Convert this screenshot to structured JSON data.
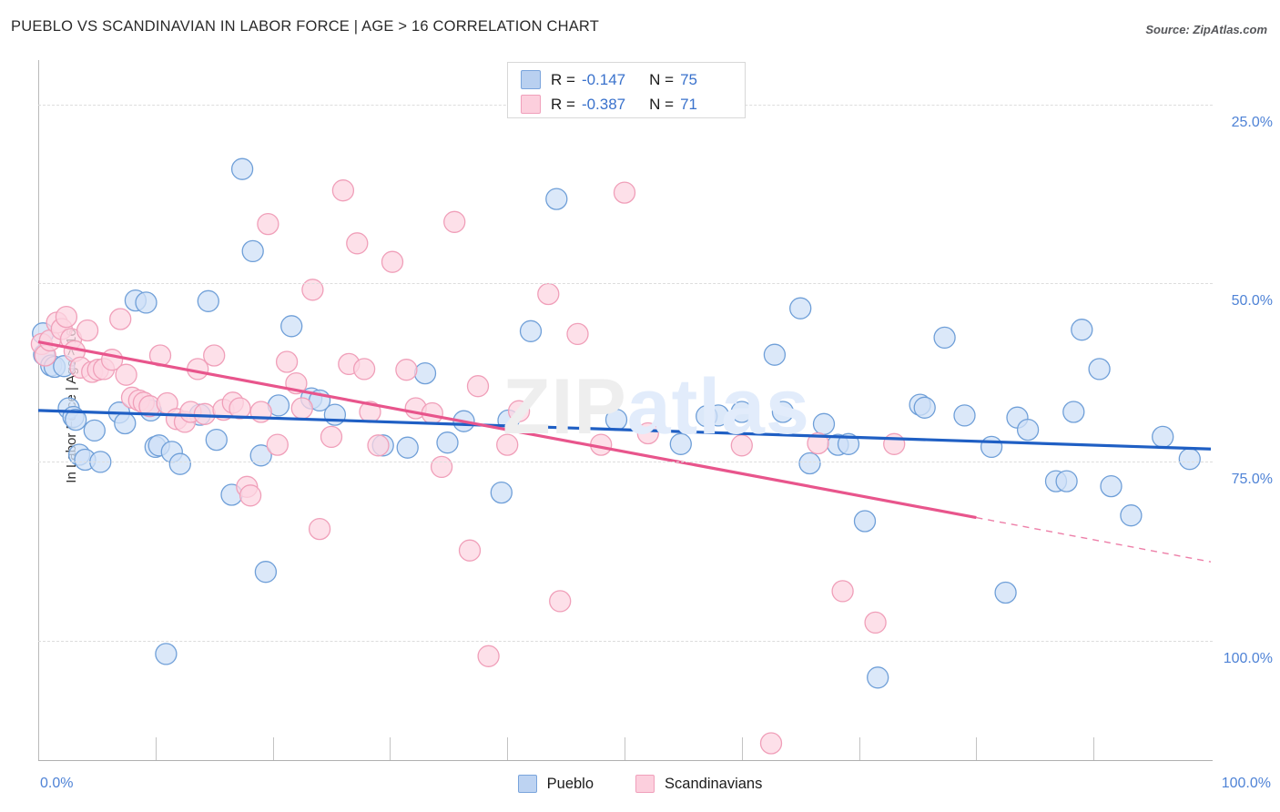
{
  "header": {
    "title": "PUEBLO VS SCANDINAVIAN IN LABOR FORCE | AGE > 16 CORRELATION CHART",
    "source": "Source: ZipAtlas.com"
  },
  "watermark": {
    "part1": "ZIP",
    "part2": "atlas"
  },
  "legend": {
    "rows": [
      {
        "series": "Pueblo",
        "r_label": "R =",
        "r_value": "-0.147",
        "n_label": "N =",
        "n_value": "75",
        "color": "#b9d0f0"
      },
      {
        "series": "Scandinavians",
        "r_label": "R =",
        "r_value": "-0.387",
        "n_label": "N =",
        "n_value": "71",
        "color": "#fccfdd"
      }
    ]
  },
  "bottom_legend": {
    "items": [
      {
        "label": "Pueblo",
        "color": "#bdd3f2"
      },
      {
        "label": "Scandinavians",
        "color": "#fccfdd"
      }
    ]
  },
  "axes": {
    "y_title": "In Labor Force | Age > 16",
    "y_ticks": [
      "100.0%",
      "75.0%",
      "50.0%",
      "25.0%"
    ],
    "x_min_label": "0.0%",
    "x_max_label": "100.0%"
  },
  "colors": {
    "blue_fill": "#cfe0f7",
    "blue_stroke": "#6f9fd8",
    "pink_fill": "#fcd6e2",
    "pink_stroke": "#f09fb9",
    "blue_line": "#1f5fc4",
    "pink_line": "#e8558c",
    "axis": "#b9b9b9",
    "grid": "#dddddd",
    "tick_text": "#4f83d6"
  },
  "chart_data": {
    "type": "scatter",
    "title": "PUEBLO VS SCANDINAVIAN IN LABOR FORCE | AGE > 16 CORRELATION CHART",
    "xlabel": "",
    "ylabel": "In Labor Force | Age > 16",
    "xlim": [
      0,
      100
    ],
    "ylim": [
      8.5,
      106
    ],
    "grid": true,
    "x_ticks": [
      0,
      100
    ],
    "y_ticks": [
      25,
      50,
      75,
      100
    ],
    "legend_position": "bottom-center",
    "series": [
      {
        "name": "Pueblo",
        "color": "#cfe0f7",
        "R": -0.147,
        "N": 75,
        "trendline": {
          "x0": 0,
          "y0": 57.2,
          "x1": 100,
          "y1": 51.8,
          "style": "solid",
          "color": "#1f5fc4"
        },
        "points": [
          [
            0.4,
            68.0
          ],
          [
            0.5,
            65.0
          ],
          [
            1.1,
            63.5
          ],
          [
            1.4,
            63.3
          ],
          [
            2.2,
            63.4
          ],
          [
            2.6,
            57.5
          ],
          [
            3.0,
            56.3
          ],
          [
            3.2,
            55.9
          ],
          [
            3.5,
            51.0
          ],
          [
            4.0,
            50.3
          ],
          [
            4.8,
            54.4
          ],
          [
            5.3,
            50.0
          ],
          [
            6.9,
            56.9
          ],
          [
            7.4,
            55.4
          ],
          [
            8.3,
            72.6
          ],
          [
            9.2,
            72.3
          ],
          [
            9.6,
            57.2
          ],
          [
            10.0,
            52.1
          ],
          [
            10.3,
            52.3
          ],
          [
            10.9,
            23.1
          ],
          [
            11.4,
            51.4
          ],
          [
            12.1,
            49.7
          ],
          [
            13.8,
            56.6
          ],
          [
            14.5,
            72.5
          ],
          [
            15.2,
            53.1
          ],
          [
            16.5,
            45.4
          ],
          [
            17.4,
            91.0
          ],
          [
            18.3,
            79.5
          ],
          [
            19.0,
            50.9
          ],
          [
            19.4,
            34.6
          ],
          [
            20.5,
            57.9
          ],
          [
            21.6,
            69.0
          ],
          [
            23.3,
            58.9
          ],
          [
            24.0,
            58.6
          ],
          [
            25.3,
            56.6
          ],
          [
            29.4,
            52.3
          ],
          [
            31.5,
            52.0
          ],
          [
            33.0,
            62.4
          ],
          [
            34.9,
            52.7
          ],
          [
            36.3,
            55.7
          ],
          [
            39.5,
            45.7
          ],
          [
            40.1,
            55.8
          ],
          [
            42.0,
            68.3
          ],
          [
            44.2,
            86.8
          ],
          [
            49.3,
            55.9
          ],
          [
            54.8,
            52.5
          ],
          [
            57.0,
            56.4
          ],
          [
            58.0,
            56.5
          ],
          [
            60.0,
            57.0
          ],
          [
            62.8,
            65.0
          ],
          [
            63.5,
            57.0
          ],
          [
            65.0,
            71.5
          ],
          [
            65.8,
            49.8
          ],
          [
            67.0,
            55.3
          ],
          [
            68.2,
            52.4
          ],
          [
            69.1,
            52.5
          ],
          [
            70.5,
            41.7
          ],
          [
            71.6,
            19.8
          ],
          [
            75.2,
            58.0
          ],
          [
            75.6,
            57.6
          ],
          [
            77.3,
            67.4
          ],
          [
            79.0,
            56.5
          ],
          [
            81.3,
            52.1
          ],
          [
            82.5,
            31.7
          ],
          [
            83.5,
            56.2
          ],
          [
            84.4,
            54.5
          ],
          [
            86.8,
            47.3
          ],
          [
            87.7,
            47.3
          ],
          [
            88.3,
            57.0
          ],
          [
            89.0,
            68.5
          ],
          [
            90.5,
            63.0
          ],
          [
            91.5,
            46.6
          ],
          [
            93.2,
            42.5
          ],
          [
            95.9,
            53.5
          ],
          [
            98.2,
            50.4
          ]
        ]
      },
      {
        "name": "Scandinavians",
        "color": "#fcd6e2",
        "R": -0.387,
        "N": 71,
        "trendline": {
          "x0": 0,
          "y0": 66.8,
          "x1": 80,
          "y1": 42.2,
          "style": "solid-then-dashed",
          "dash_from_x": 80,
          "dash_to_x": 100,
          "dash_to_y": 36.0,
          "color": "#e8558c"
        },
        "points": [
          [
            0.3,
            66.5
          ],
          [
            0.6,
            64.9
          ],
          [
            1.0,
            67.0
          ],
          [
            1.6,
            69.5
          ],
          [
            2.0,
            68.6
          ],
          [
            2.4,
            70.3
          ],
          [
            2.8,
            67.2
          ],
          [
            3.1,
            65.5
          ],
          [
            3.6,
            63.2
          ],
          [
            4.2,
            68.4
          ],
          [
            4.6,
            62.6
          ],
          [
            5.1,
            62.9
          ],
          [
            5.6,
            63.0
          ],
          [
            6.3,
            64.3
          ],
          [
            7.0,
            70.0
          ],
          [
            7.5,
            62.2
          ],
          [
            8.0,
            59.0
          ],
          [
            8.6,
            58.6
          ],
          [
            9.0,
            58.3
          ],
          [
            9.5,
            57.8
          ],
          [
            10.4,
            64.9
          ],
          [
            11.0,
            58.2
          ],
          [
            11.8,
            56.0
          ],
          [
            12.5,
            55.6
          ],
          [
            13.0,
            57.0
          ],
          [
            13.6,
            63.0
          ],
          [
            14.2,
            56.7
          ],
          [
            15.0,
            64.9
          ],
          [
            15.8,
            57.3
          ],
          [
            16.6,
            58.3
          ],
          [
            17.2,
            57.5
          ],
          [
            17.8,
            46.5
          ],
          [
            18.1,
            45.3
          ],
          [
            19.0,
            57.0
          ],
          [
            19.6,
            83.3
          ],
          [
            20.4,
            52.4
          ],
          [
            21.2,
            64.0
          ],
          [
            22.0,
            61.0
          ],
          [
            22.5,
            57.5
          ],
          [
            23.4,
            74.1
          ],
          [
            24.0,
            40.6
          ],
          [
            25.0,
            53.5
          ],
          [
            26.0,
            88.0
          ],
          [
            26.5,
            63.7
          ],
          [
            27.2,
            80.6
          ],
          [
            27.8,
            63.0
          ],
          [
            28.3,
            57.0
          ],
          [
            29.0,
            52.3
          ],
          [
            30.2,
            78.0
          ],
          [
            31.4,
            62.9
          ],
          [
            32.2,
            57.5
          ],
          [
            33.6,
            56.8
          ],
          [
            34.4,
            49.3
          ],
          [
            35.5,
            83.6
          ],
          [
            36.8,
            37.6
          ],
          [
            37.5,
            60.6
          ],
          [
            38.4,
            22.8
          ],
          [
            40.0,
            52.4
          ],
          [
            41.0,
            57.1
          ],
          [
            43.5,
            73.5
          ],
          [
            44.5,
            30.5
          ],
          [
            46.0,
            67.9
          ],
          [
            48.0,
            52.4
          ],
          [
            50.0,
            87.7
          ],
          [
            52.0,
            54.0
          ],
          [
            60.0,
            52.3
          ],
          [
            66.5,
            52.6
          ],
          [
            68.6,
            31.9
          ],
          [
            71.4,
            27.5
          ],
          [
            73.0,
            52.5
          ],
          [
            62.5,
            10.6
          ]
        ]
      }
    ]
  }
}
